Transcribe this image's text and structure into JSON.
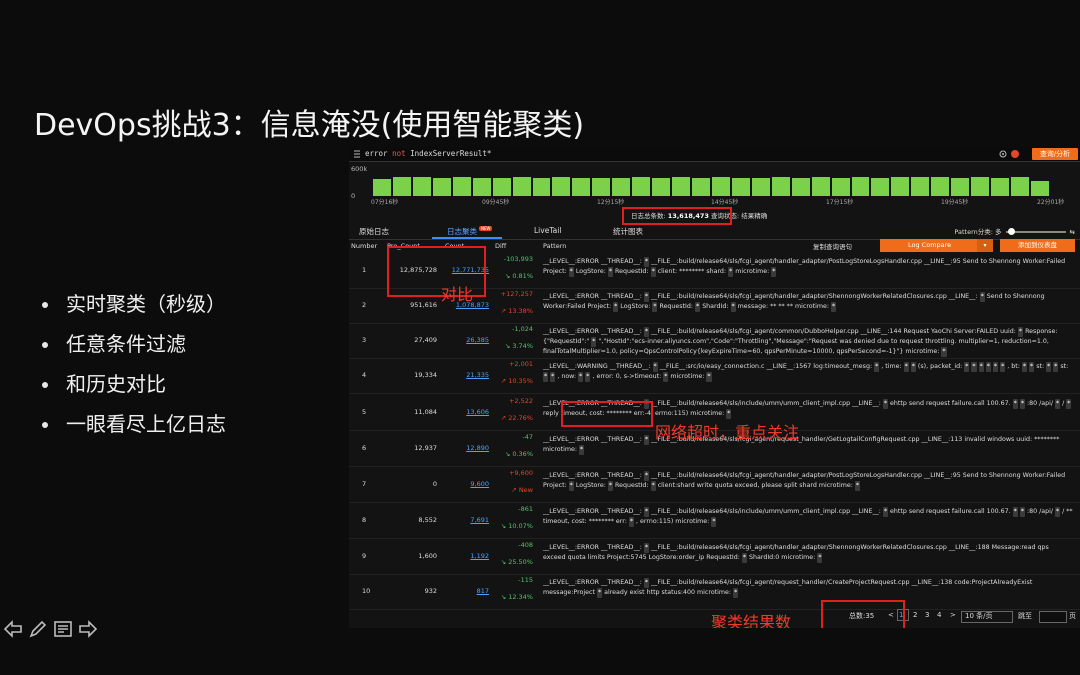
{
  "slide": {
    "title": "DevOps挑战3：信息淹没(使用智能聚类)",
    "bullets": [
      "实时聚类（秒级）",
      "任意条件过滤",
      "和历史对比",
      "一眼看尽上亿日志"
    ]
  },
  "query": {
    "text_pre": "error ",
    "keyword": "not",
    "text_post": " IndexServerResult*",
    "button": "查询/分析"
  },
  "histogram": {
    "y_top": "600k",
    "y_bottom": "0",
    "bar_levels": [
      0.82,
      0.9,
      0.9,
      0.88,
      0.9,
      0.86,
      0.88,
      0.9,
      0.88,
      0.9,
      0.86,
      0.86,
      0.88,
      0.9,
      0.88,
      0.9,
      0.86,
      0.9,
      0.88,
      0.88,
      0.9,
      0.88,
      0.9,
      0.86,
      0.9,
      0.88,
      0.9,
      0.9,
      0.9,
      0.86,
      0.9,
      0.88,
      0.9,
      0.72
    ],
    "ticks": [
      "07分16秒",
      "09分45秒",
      "12分15秒",
      "14分45秒",
      "17分15秒",
      "19分45秒",
      "22分01秒"
    ]
  },
  "summary": {
    "total_label": "日志总条数:",
    "total": "13,618,473",
    "status_label": "查询状态:",
    "status": "结果精确"
  },
  "tabs": [
    "原始日志",
    "日志聚类",
    "LiveTail",
    "统计图表"
  ],
  "tab_new_badge": "NEW",
  "pattern_split": {
    "label": "Pattern分类:",
    "value": "多"
  },
  "columns": [
    "Number",
    "Pre_Count",
    "Count",
    "Diff",
    "Pattern"
  ],
  "actions": {
    "copy": "复制查询语句",
    "compare": "Log Compare",
    "add": "添加到仪表盘"
  },
  "rows": [
    {
      "num": "1",
      "pre": "12,875,728",
      "count": "12,771,735",
      "diff": "-103,993",
      "pct": "0.81%",
      "dir": "down",
      "pattern": "__LEVEL__:ERROR __THREAD__: ▪ __FILE__:build/release64/sls/fcgi_agent/handler_adapter/PostLogStoreLogsHandler.cpp __LINE__:95 Send to Shennong Worker:Failed Project: ▪ LogStore: ▪ RequestId: ▪ client: ******** shard: ▪ microtime: ▪"
    },
    {
      "num": "2",
      "pre": "951,616",
      "count": "1,078,873",
      "diff": "+127,257",
      "pct": "13.38%",
      "dir": "up",
      "pattern": "__LEVEL__:ERROR __THREAD__: ▪ __FILE__:build/release64/sls/fcgi_agent/handler_adapter/ShennongWorkerRelatedClosures.cpp __LINE__: ▪ Send to Shennong Worker:Failed Project: ▪ LogStore: ▪ RequestId: ▪ ShardId: ▪ message: ** ** ** microtime: ▪"
    },
    {
      "num": "3",
      "pre": "27,409",
      "count": "26,385",
      "diff": "-1,024",
      "pct": "3.74%",
      "dir": "down",
      "pattern": "__LEVEL__:ERROR __THREAD__: ▪ __FILE__:build/release64/sls/fcgi_agent/common/DubboHelper.cpp __LINE__:144 Request YaoChi Server:FAILED uuid: ▪ Response:{\"RequestId\":\" ▪ \",\"HostId\":\"ecs-inner.aliyuncs.com\",\"Code\":\"Throttling\",\"Message\":\"Request was denied due to request throttling. multiplier=1, reduction=1.0, finalTotalMultiplier=1.0, policy=QpsControlPolicy{keyExpireTime=60, qpsPerMinute=10000, qpsPerSecond=-1}\"} microtime: ▪"
    },
    {
      "num": "4",
      "pre": "19,334",
      "count": "21,335",
      "diff": "+2,001",
      "pct": "10.35%",
      "dir": "up",
      "pattern": "__LEVEL__:WARNING __THREAD__: ▪ __FILE__:src/io/easy_connection.c __LINE__:1567 log:timeout_mesg: ▪ , time: ▪ ▪ (s), packet_id: ▪ ▪ ▪ ▪ ▪ ▪ , bt: ▪ ▪ st: ▪ ▪ st: ▪ ▪ , now: ▪ ▪ , error: 0, s->timeout: ▪ microtime: ▪"
    },
    {
      "num": "5",
      "pre": "11,084",
      "count": "13,606",
      "diff": "+2,522",
      "pct": "22.76%",
      "dir": "up",
      "pattern": "__LEVEL__:ERROR __THREAD__: ▪ __FILE__:build/release64/sls/include/umm/umm_client_impl.cpp __LINE__: ▪ ehttp send request failure.call 100.67. ▪ ▪ :80 /api/ ▪ / ▪ reply timeout, cost: ******** err:-4, errno:115) microtime: ▪"
    },
    {
      "num": "6",
      "pre": "12,937",
      "count": "12,890",
      "diff": "-47",
      "pct": "0.36%",
      "dir": "down",
      "pattern": "__LEVEL__:ERROR __THREAD__: ▪ __FILE__:build/release64/sls/fcgi_agent/request_handler/GetLogtailConfigRequest.cpp __LINE__:113 invalid windows uuid: ******** microtime: ▪"
    },
    {
      "num": "7",
      "pre": "0",
      "count": "9,600",
      "diff": "+9,600",
      "pct": "New",
      "dir": "up",
      "pattern": "__LEVEL__:ERROR __THREAD__: ▪ __FILE__:build/release64/sls/fcgi_agent/handler_adapter/PostLogStoreLogsHandler.cpp __LINE__:95 Send to Shennong Worker:Failed Project: ▪ LogStore: ▪ RequestId: ▪ client:shard write quota exceed, please split shard microtime: ▪"
    },
    {
      "num": "8",
      "pre": "8,552",
      "count": "7,691",
      "diff": "-861",
      "pct": "10.07%",
      "dir": "down",
      "pattern": "__LEVEL__:ERROR __THREAD__: ▪ __FILE__:build/release64/sls/include/umm/umm_client_impl.cpp __LINE__: ▪ ehttp send request failure.call 100.67. ▪ ▪ :80 /api/ ▪ / ** timeout, cost: ******** err: ▪ , errno:115) microtime: ▪"
    },
    {
      "num": "9",
      "pre": "1,600",
      "count": "1,192",
      "diff": "-408",
      "pct": "25.50%",
      "dir": "down",
      "pattern": "__LEVEL__:ERROR __THREAD__: ▪ __FILE__:build/release64/sls/fcgi_agent/handler_adapter/ShennongWorkerRelatedClosures.cpp __LINE__:188 Message:read qps exceed quota limits Project:5745 LogStore:order_ip RequestId: ▪ ShardId:0 microtime: ▪"
    },
    {
      "num": "10",
      "pre": "932",
      "count": "817",
      "diff": "-115",
      "pct": "12.34%",
      "dir": "down",
      "pattern": "__LEVEL__:ERROR __THREAD__: ▪ __FILE__:build/release64/sls/fcgi_agent/request_handler/CreateProjectRequest.cpp __LINE__:138 code:ProjectAlreadyExist message:Project ▪ already exist http status:400 microtime: ▪"
    }
  ],
  "pager": {
    "total": "总数:35",
    "prev": "<",
    "pages": [
      "1",
      "2",
      "3",
      "4"
    ],
    "next": ">",
    "per_page": "10 条/页",
    "goto": "跳至",
    "page_suffix": "页"
  },
  "annotations": {
    "compare": "对比",
    "timeout": "网络超时，重点关注",
    "result": "聚类结果数"
  },
  "colors": {
    "accent": "#ef6c1a",
    "bar": "#7bd24a",
    "annotation": "#e02020",
    "link": "#4da3ff"
  }
}
